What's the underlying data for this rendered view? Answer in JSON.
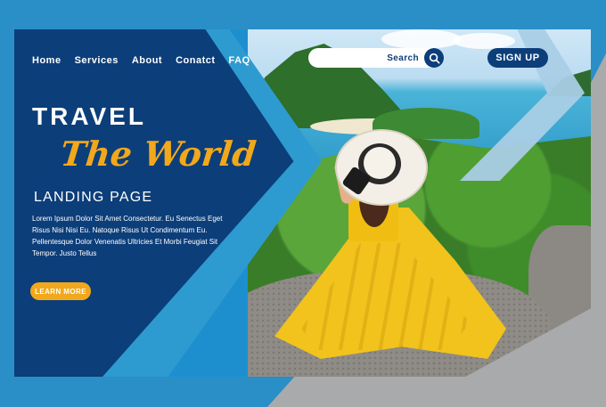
{
  "nav": {
    "items": [
      {
        "label": "Home"
      },
      {
        "label": "Services"
      },
      {
        "label": "About"
      },
      {
        "label": "Conatct"
      },
      {
        "label": "FAQ"
      }
    ]
  },
  "search": {
    "label": "Search",
    "icon": "search-icon"
  },
  "signup": {
    "label": "SIGN UP"
  },
  "hero": {
    "title_line1": "TRAVEL",
    "title_line2": "The World",
    "subtitle": "LANDING PAGE",
    "body": "Lorem Ipsum Dolor Sit Amet Consectetur. Eu Senectus Eget Risus Nisi Nisi Eu. Natoque Risus Ut Condimentum Eu. Pellentesque Dolor Venenatis Ultricies Et Morbi Feugiat Sit Tempor. Justo Tellus",
    "cta": "LEARN MORE"
  },
  "colors": {
    "navy": "#0c3e7a",
    "blue": "#2e9bd0",
    "accent": "#f2a81b",
    "gray": "#a9aaac"
  }
}
